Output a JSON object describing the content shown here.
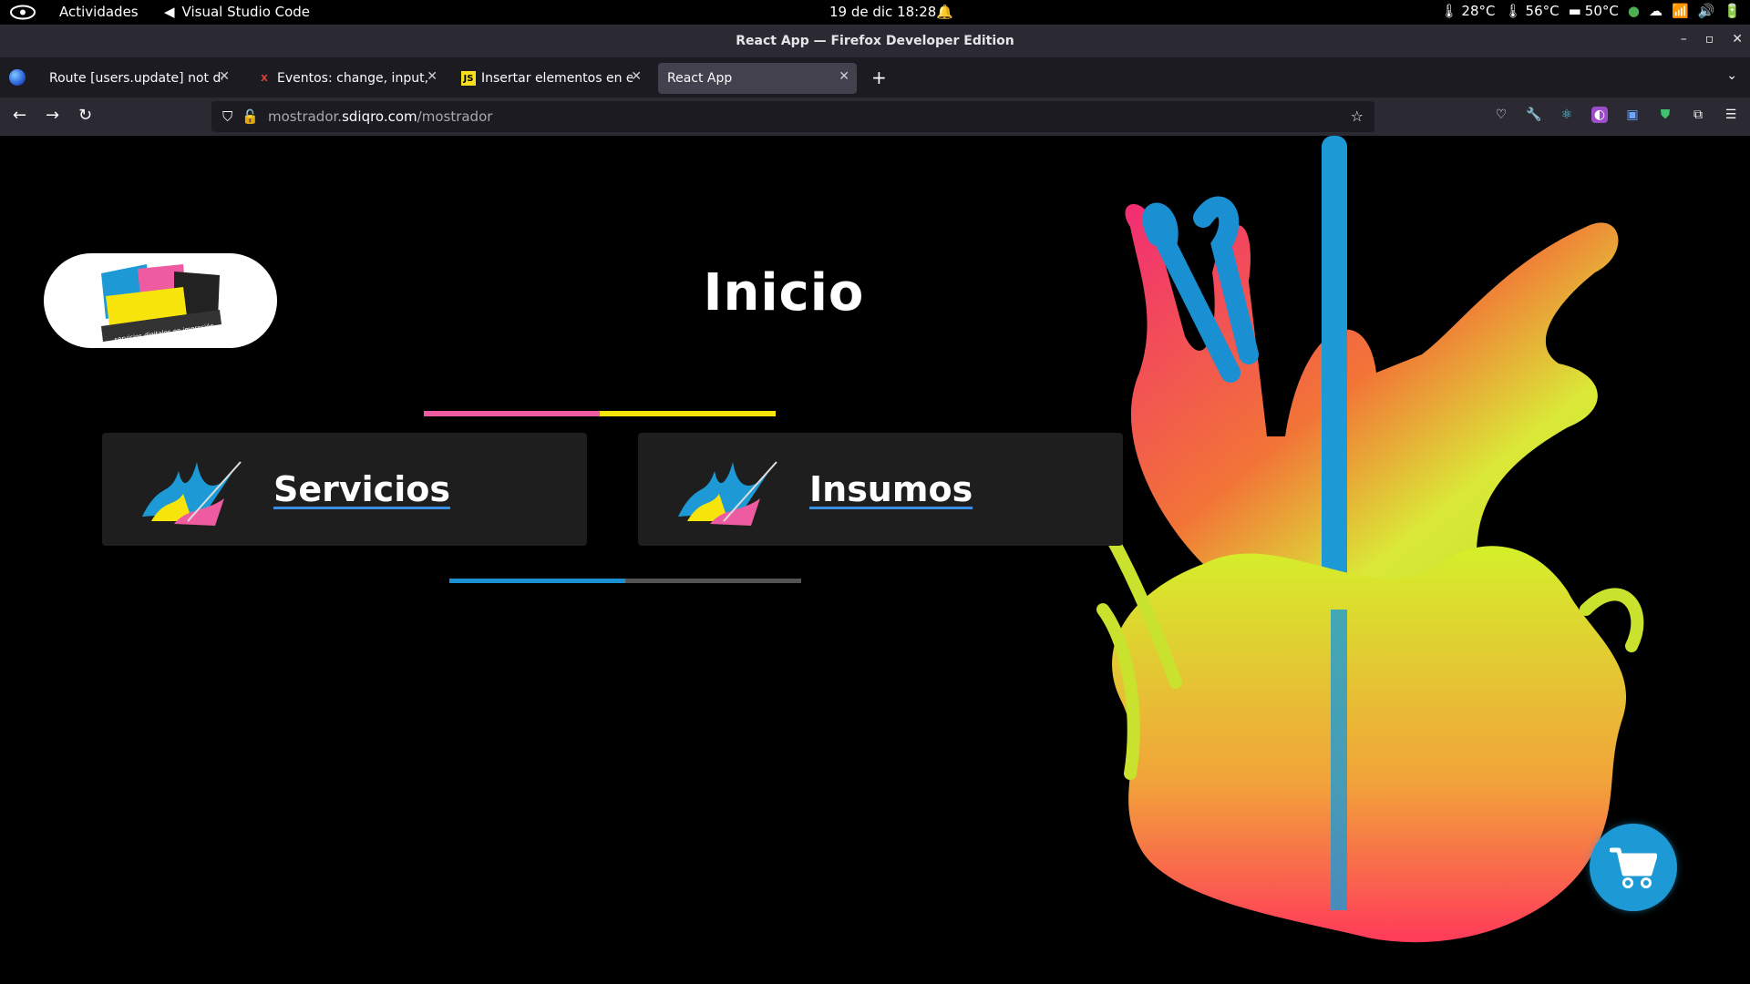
{
  "system_bar": {
    "activities": "Actividades",
    "app_name": "Visual Studio Code",
    "clock": "19 de dic  18:28",
    "temps": [
      "28°C",
      "56°C",
      "50°C"
    ]
  },
  "window": {
    "title": "React App — Firefox Developer Edition"
  },
  "tabs": [
    {
      "label": "Route [users.update] not de",
      "active": false
    },
    {
      "label": "Eventos: change, input, c",
      "active": false
    },
    {
      "label": "Insertar elementos en el",
      "active": false
    },
    {
      "label": "React App",
      "active": true
    }
  ],
  "url": {
    "prefix": "mostrador.",
    "domain": "sdiqro.com",
    "path": "/mostrador"
  },
  "page": {
    "heading": "Inicio",
    "logo_text": "servicios digitales en impresión",
    "cards": [
      {
        "label": "Servicios"
      },
      {
        "label": "Insumos"
      }
    ]
  },
  "colors": {
    "magenta": "#ee5ba0",
    "yellow": "#f6e40a",
    "cyan": "#1a8fd2",
    "cart": "#1d9ad6"
  }
}
